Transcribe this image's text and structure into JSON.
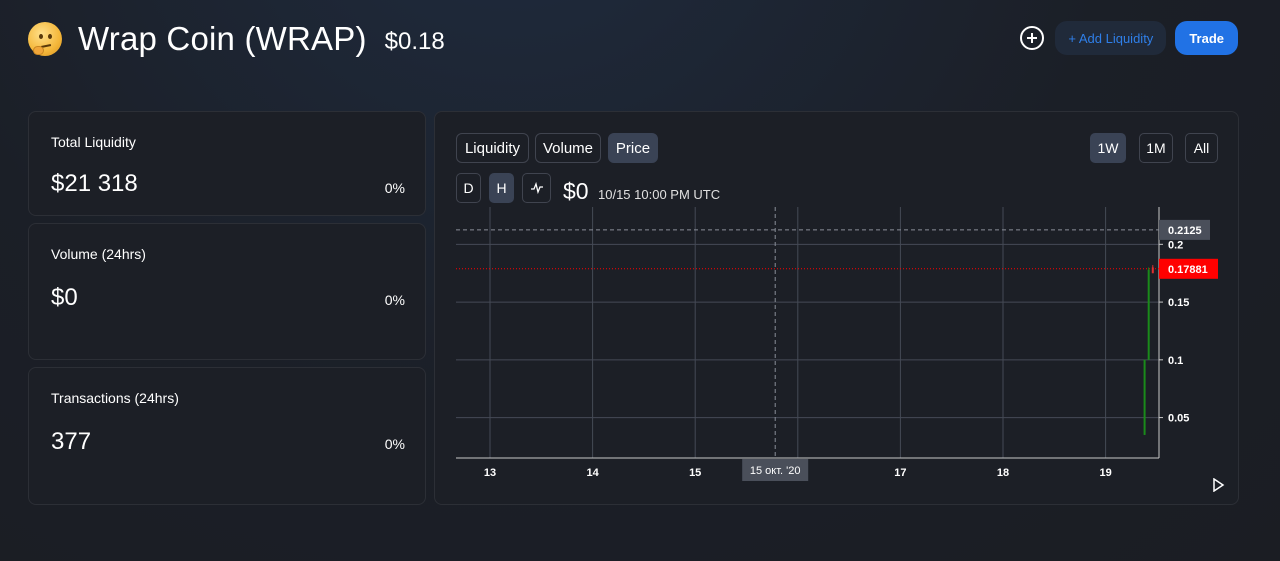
{
  "header": {
    "emoji_icon": "thinking-face-icon",
    "title": "Wrap Coin (WRAP)",
    "price": "$0.18",
    "add_liquidity_label": "+ Add Liquidity",
    "trade_label": "Trade"
  },
  "stats": [
    {
      "label": "Total Liquidity",
      "value": "$21 318",
      "change": "0%"
    },
    {
      "label": "Volume (24hrs)",
      "value": "$0",
      "change": "0%"
    },
    {
      "label": "Transactions (24hrs)",
      "value": "377",
      "change": "0%"
    }
  ],
  "chart": {
    "tabs": [
      "Liquidity",
      "Volume",
      "Price"
    ],
    "active_tab": "Price",
    "ranges": [
      "1W",
      "1M",
      "All"
    ],
    "active_range": "1W",
    "intervals": [
      "D",
      "H"
    ],
    "active_interval": "H",
    "crosshair_price": "$0",
    "crosshair_time": "10/15 10:00 PM UTC"
  },
  "chart_data": {
    "type": "candlestick",
    "x_ticks": [
      "13",
      "14",
      "15",
      "17",
      "18",
      "19"
    ],
    "crosshair_x_label": "15 окт. '20",
    "y_ticks": [
      "0.05",
      "0.1",
      "0.15",
      "0.2"
    ],
    "ylim": [
      0.015,
      0.22
    ],
    "crosshair_y_label": "0.2125",
    "crosshair_y_value": 0.2125,
    "last_price_label": "0.17881",
    "last_price": 0.17881,
    "candles": [
      {
        "day": 19.38,
        "open": 0.035,
        "close": 0.1,
        "high": 0.1,
        "low": 0.035,
        "color": "#1a8a1a"
      },
      {
        "day": 19.42,
        "open": 0.1,
        "close": 0.178,
        "high": 0.18,
        "low": 0.1,
        "color": "#1a8a1a"
      },
      {
        "day": 19.46,
        "open": 0.18,
        "close": 0.175,
        "high": 0.182,
        "low": 0.175,
        "color": "#e03030"
      }
    ],
    "grid": true,
    "colors": {
      "up": "#1a8a1a",
      "down": "#e03030",
      "last_price": "#ff0000"
    }
  }
}
